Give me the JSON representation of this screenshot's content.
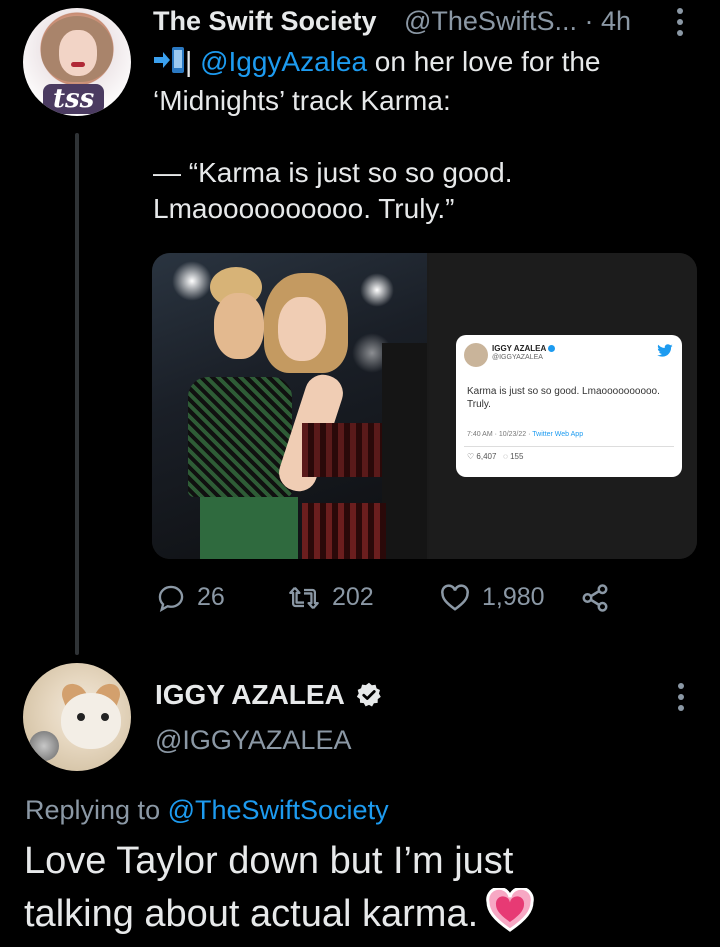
{
  "tweet1": {
    "display_name": "The Swift Society",
    "handle_time": "@TheSwiftS... · 4h",
    "avatar_mark": "tss",
    "text_line1_suffix": "| ",
    "mention": "@IggyAzalea",
    "text_line1_rest": " on her love for the",
    "text_line2": "‘Midnights’ track Karma:",
    "text_line4": "— “Karma is just so so good.",
    "text_line5": "Lmaoooooooooo. Truly.”",
    "leading_icon": "arrow-into-phone-icon",
    "media": {
      "embedded_tweet": {
        "name": "IGGY AZALEA",
        "handle": "@IGGYAZALEA",
        "body": "Karma is just so so good. Lmaoooooooooo. Truly.",
        "time": "7:40 AM · 10/23/22 · ",
        "source": "Twitter Web App",
        "likes": "6,407",
        "replies": "155"
      }
    },
    "actions": {
      "reply_count": "26",
      "retweet_count": "202",
      "like_count": "1,980"
    }
  },
  "tweet2": {
    "display_name": "IGGY AZALEA",
    "handle": "@IGGYAZALEA",
    "replying_prefix": "Replying to ",
    "replying_to": "@TheSwiftSociety",
    "text_line1": "Love Taylor down but I’m just",
    "text_line2": "talking about actual karma.",
    "emoji": "pink-heart-emoji"
  },
  "colors": {
    "background": "#000000",
    "text": "#e7e9ea",
    "muted": "#8b98a5",
    "link": "#1d9bf0"
  }
}
